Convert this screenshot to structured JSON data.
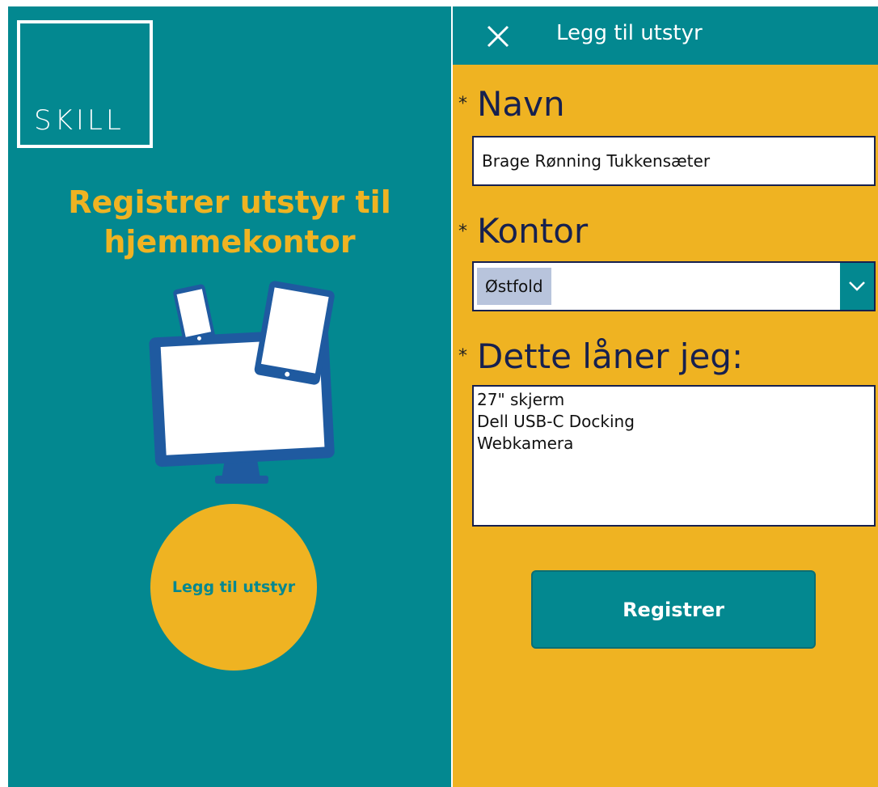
{
  "left": {
    "logo_text": "SKILL",
    "title_line1": "Registrer utstyr til",
    "title_line2": "hjemmekontor",
    "illustration_icon": "devices-icon",
    "start_button_label": "Legg til utstyr"
  },
  "form": {
    "header_title": "Legg til utstyr",
    "close_icon": "close-icon",
    "required_mark": "*",
    "name_label": "Navn",
    "name_value": "Brage Rønning Tukkensæter",
    "office_label": "Kontor",
    "office_value": "Østfold",
    "loan_label": "Dette låner jeg:",
    "loan_items": [
      "27\" skjerm",
      "Dell USB-C Docking",
      "Webkamera"
    ],
    "submit_label": "Registrer"
  },
  "colors": {
    "teal": "#038890",
    "yellow": "#efb322",
    "navy": "#16204f",
    "selection": "#b8c4dc"
  }
}
